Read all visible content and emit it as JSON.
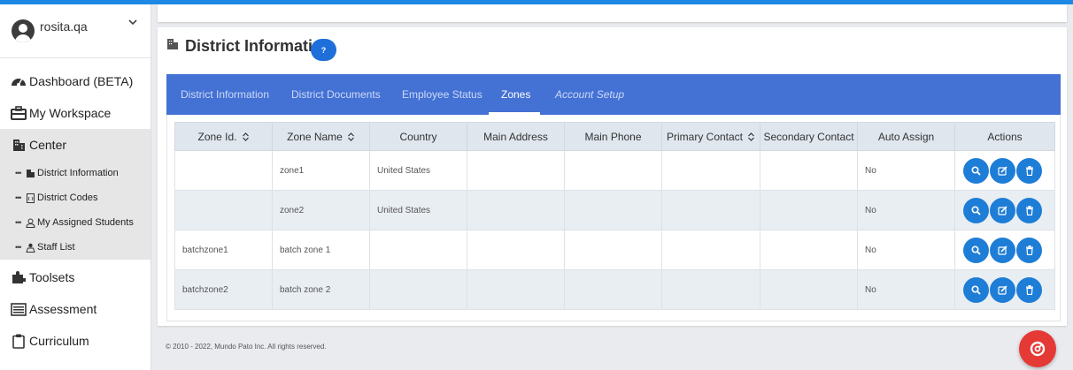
{
  "user": {
    "name": "rosita.qa"
  },
  "sidebar": {
    "items": [
      {
        "label": "Dashboard (BETA)",
        "icon": "dashboard-icon"
      },
      {
        "label": "My Workspace",
        "icon": "briefcase-icon"
      },
      {
        "label": "Center",
        "icon": "building-icon"
      },
      {
        "label": "Toolsets",
        "icon": "puzzle-icon"
      },
      {
        "label": "Assessment",
        "icon": "list-icon"
      },
      {
        "label": "Curriculum",
        "icon": "clipboard-icon"
      }
    ],
    "subitems": [
      {
        "label": "District Information",
        "icon": "building-small-icon"
      },
      {
        "label": "District Codes",
        "icon": "code-file-icon"
      },
      {
        "label": "My Assigned Students",
        "icon": "student-icon"
      },
      {
        "label": "Staff List",
        "icon": "staff-icon"
      }
    ]
  },
  "page": {
    "title": "District Information",
    "help_label": "?"
  },
  "tabs": [
    {
      "label": "District Information"
    },
    {
      "label": "District Documents"
    },
    {
      "label": "Employee Status"
    },
    {
      "label": "Zones"
    },
    {
      "label": "Account Setup"
    }
  ],
  "table": {
    "columns": [
      "Zone Id.",
      "Zone Name",
      "Country",
      "Main Address",
      "Main Phone",
      "Primary Contact",
      "Secondary Contact",
      "Auto Assign",
      "Actions"
    ],
    "rows": [
      {
        "zone_id": "",
        "zone_name": "zone1",
        "country": "United States",
        "main_address": "",
        "main_phone": "",
        "primary_contact": "",
        "secondary_contact": "",
        "auto_assign": "No"
      },
      {
        "zone_id": "",
        "zone_name": "zone2",
        "country": "United States",
        "main_address": "",
        "main_phone": "",
        "primary_contact": "",
        "secondary_contact": "",
        "auto_assign": "No"
      },
      {
        "zone_id": "batchzone1",
        "zone_name": "batch zone 1",
        "country": "",
        "main_address": "",
        "main_phone": "",
        "primary_contact": "",
        "secondary_contact": "",
        "auto_assign": "No"
      },
      {
        "zone_id": "batchzone2",
        "zone_name": "batch zone 2",
        "country": "",
        "main_address": "",
        "main_phone": "",
        "primary_contact": "",
        "secondary_contact": "",
        "auto_assign": "No"
      }
    ]
  },
  "footer": {
    "copyright": "© 2010 - 2022, Mundo Pato Inc. All rights reserved."
  },
  "colors": {
    "accent": "#1e88e5",
    "tabbar": "#4371d4",
    "action_button": "#1e7dd6",
    "fab": "#e53935"
  }
}
